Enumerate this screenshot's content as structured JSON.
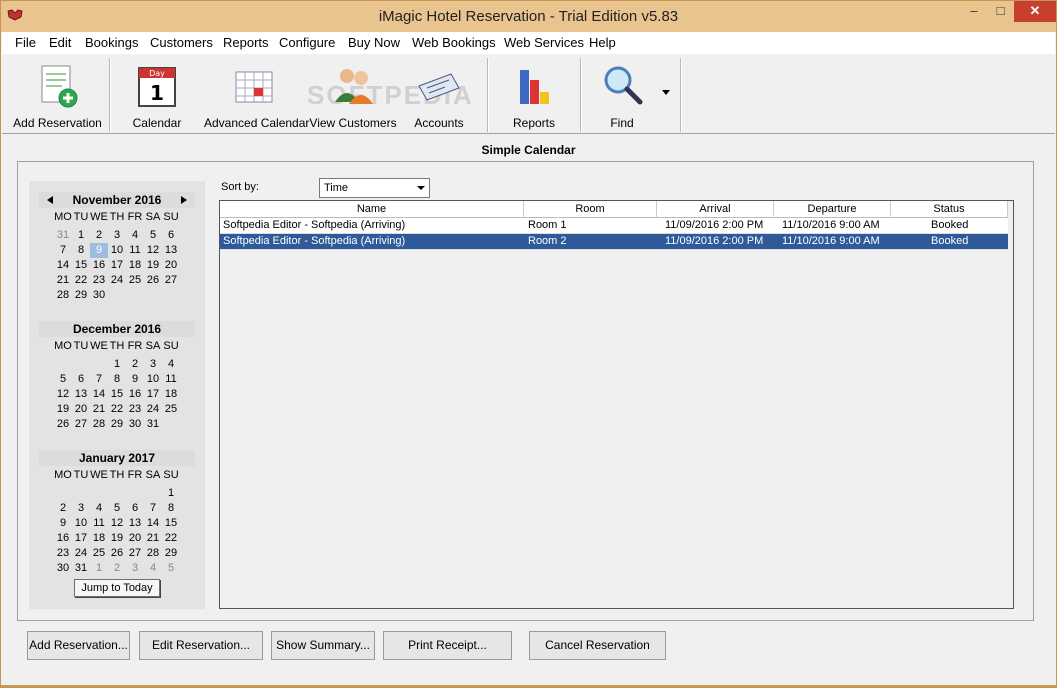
{
  "window": {
    "title": "iMagic Hotel Reservation - Trial Edition v5.83",
    "min": "–",
    "max": "□",
    "close": "✕"
  },
  "menu": [
    "File",
    "Edit",
    "Bookings",
    "Customers",
    "Reports",
    "Configure",
    "Buy Now",
    "Web Bookings",
    "Web Services",
    "Help"
  ],
  "toolbar": {
    "add_reservation": "Add Reservation",
    "calendar": "Calendar",
    "calendar_day": "Day",
    "calendar_num": "1",
    "advanced_calendar": "Advanced Calendar",
    "view_customers": "View Customers",
    "accounts": "Accounts",
    "reports": "Reports",
    "find": "Find",
    "watermark": "SOFTPEDIA"
  },
  "section_title": "Simple Calendar",
  "calendar": {
    "months": [
      {
        "name": "November 2016",
        "dow": [
          "MO",
          "TU",
          "WE",
          "TH",
          "FR",
          "SA",
          "SU"
        ],
        "weeks": [
          [
            "31",
            "1",
            "2",
            "3",
            "4",
            "5",
            "6"
          ],
          [
            "7",
            "8",
            "9",
            "10",
            "11",
            "12",
            "13"
          ],
          [
            "14",
            "15",
            "16",
            "17",
            "18",
            "19",
            "20"
          ],
          [
            "21",
            "22",
            "23",
            "24",
            "25",
            "26",
            "27"
          ],
          [
            "28",
            "29",
            "30",
            "",
            "",
            "",
            ""
          ]
        ]
      },
      {
        "name": "December 2016",
        "dow": [
          "MO",
          "TU",
          "WE",
          "TH",
          "FR",
          "SA",
          "SU"
        ],
        "weeks": [
          [
            "",
            "",
            "",
            "1",
            "2",
            "3",
            "4"
          ],
          [
            "5",
            "6",
            "7",
            "8",
            "9",
            "10",
            "11"
          ],
          [
            "12",
            "13",
            "14",
            "15",
            "16",
            "17",
            "18"
          ],
          [
            "19",
            "20",
            "21",
            "22",
            "23",
            "24",
            "25"
          ],
          [
            "26",
            "27",
            "28",
            "29",
            "30",
            "31",
            ""
          ]
        ]
      },
      {
        "name": "January 2017",
        "dow": [
          "MO",
          "TU",
          "WE",
          "TH",
          "FR",
          "SA",
          "SU"
        ],
        "weeks": [
          [
            "",
            "",
            "",
            "",
            "",
            "",
            "1"
          ],
          [
            "2",
            "3",
            "4",
            "5",
            "6",
            "7",
            "8"
          ],
          [
            "9",
            "10",
            "11",
            "12",
            "13",
            "14",
            "15"
          ],
          [
            "16",
            "17",
            "18",
            "19",
            "20",
            "21",
            "22"
          ],
          [
            "23",
            "24",
            "25",
            "26",
            "27",
            "28",
            "29"
          ],
          [
            "30",
            "31",
            "1",
            "2",
            "3",
            "4",
            "5"
          ]
        ]
      }
    ],
    "jump_label": "Jump to Today"
  },
  "sort": {
    "label": "Sort by:",
    "value": "Time"
  },
  "grid": {
    "columns": [
      "Name",
      "Room",
      "Arrival",
      "Departure",
      "Status"
    ],
    "rows": [
      [
        "Softpedia Editor - Softpedia (Arriving)",
        "Room 1",
        "11/09/2016 2:00 PM",
        "11/10/2016 9:00 AM",
        "Booked"
      ],
      [
        "Softpedia Editor - Softpedia (Arriving)",
        "Room 2",
        "11/09/2016 2:00 PM",
        "11/10/2016 9:00 AM",
        "Booked"
      ]
    ]
  },
  "buttons": {
    "add": "Add Reservation...",
    "edit": "Edit Reservation...",
    "summary": "Show Summary...",
    "print": "Print Receipt...",
    "cancel": "Cancel Reservation"
  }
}
